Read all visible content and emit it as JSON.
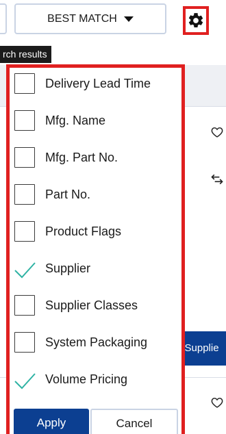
{
  "toolbar": {
    "sort_label": "BEST MATCH",
    "tooltip_text": "rch results"
  },
  "columns_popup": {
    "options": [
      {
        "label": "Delivery Lead Time",
        "checked": false
      },
      {
        "label": "Mfg. Name",
        "checked": false
      },
      {
        "label": "Mfg. Part No.",
        "checked": false
      },
      {
        "label": "Part No.",
        "checked": false
      },
      {
        "label": "Product Flags",
        "checked": false
      },
      {
        "label": "Supplier",
        "checked": true
      },
      {
        "label": "Supplier Classes",
        "checked": false
      },
      {
        "label": "System Packaging",
        "checked": false
      },
      {
        "label": "Volume Pricing",
        "checked": true
      }
    ],
    "apply_label": "Apply",
    "cancel_label": "Cancel"
  },
  "background": {
    "supplier_button_partial": "n Supplie"
  },
  "colors": {
    "accent_blue": "#0c3f91",
    "highlight_red": "#e02020",
    "check_teal": "#2fb3a4"
  },
  "icons": [
    "gear-icon",
    "caret-down-icon",
    "heart-icon",
    "swap-icon",
    "check-icon"
  ]
}
